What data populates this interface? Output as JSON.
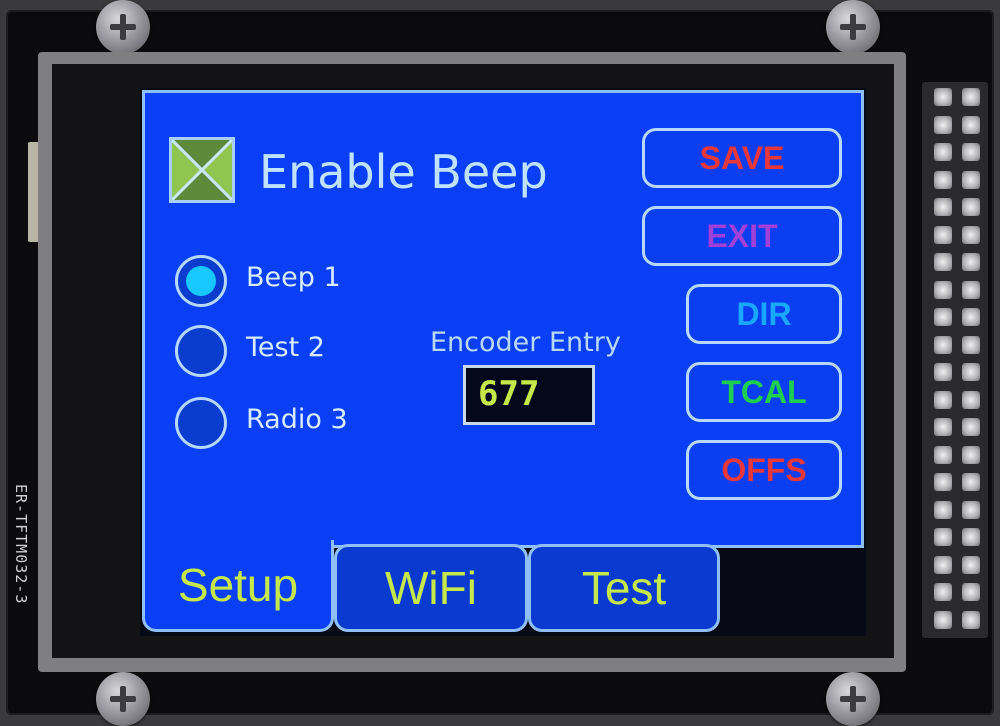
{
  "device": {
    "module_label": "ER-TFTM032-3"
  },
  "screen": {
    "checkbox": {
      "label": "Enable Beep",
      "checked": true
    },
    "radios": [
      {
        "label": "Beep 1",
        "selected": true
      },
      {
        "label": "Test 2",
        "selected": false
      },
      {
        "label": "Radio 3",
        "selected": false
      }
    ],
    "encoder": {
      "label": "Encoder Entry",
      "value": "677"
    },
    "buttons": [
      {
        "label": "SAVE",
        "color": "#e8373a"
      },
      {
        "label": "EXIT",
        "color": "#a040d8"
      },
      {
        "label": "DIR",
        "color": "#1aa8ff"
      },
      {
        "label": "TCAL",
        "color": "#1fd050"
      },
      {
        "label": "OFFS",
        "color": "#e8373a"
      }
    ],
    "tabs": [
      {
        "label": "Setup",
        "active": true
      },
      {
        "label": "WiFi",
        "active": false
      },
      {
        "label": "Test",
        "active": false
      }
    ]
  },
  "colors": {
    "panel_bg": "#0a3ff5",
    "panel_border": "#8fc0f5",
    "tab_text": "#c5e84a",
    "checkbox_fill": "#8fc650",
    "radio_selected": "#19c7ff"
  },
  "icons": [
    "screw-icon",
    "checkbox-x-icon",
    "header-pin-icon"
  ]
}
